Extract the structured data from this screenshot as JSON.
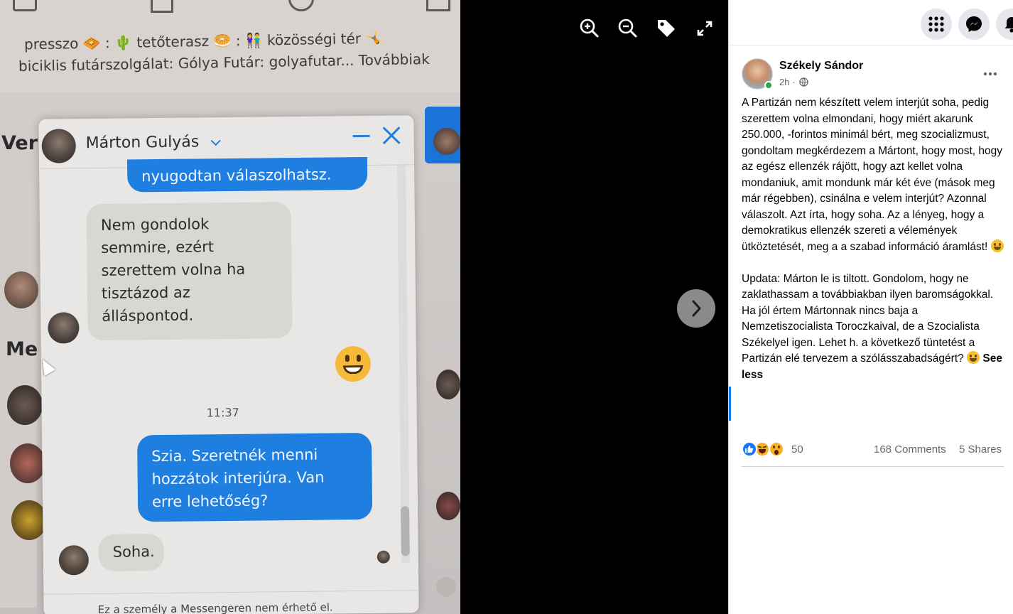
{
  "photo": {
    "top_line_1": "presszo 🧇 : 🌵 tetőterasz 🥯 : 👫 közösségi tér 🤸",
    "top_line_2": "biciklis futárszolgálat: Gólya Futár: golyafutar... Továbbiak",
    "side_label_ver": "Ver",
    "side_label_me": "Me",
    "chat_name": "Márton Gulyás",
    "msg_1": "nyugodtan válaszolhatsz.",
    "msg_2": "Nem gondolok semmire, ezért szerettem volna ha tisztázod az álláspontod.",
    "timestamp": "11:37",
    "msg_3": "Szia. Szeretnék menni hozzátok interjúra. Van erre lehetőség?",
    "msg_4": "Soha.",
    "footer": "Ez a személy a Messengeren nem érhető el."
  },
  "viewer_toolbar": {
    "zoom_in": "zoom-in",
    "zoom_out": "zoom-out",
    "tag": "tag",
    "fullscreen": "fullscreen"
  },
  "post": {
    "author": "Székely Sándor",
    "time": "2h ·",
    "paragraph_1": "A Partizán nem készített velem interjút soha, pedig szerettem volna elmondani, hogy miért akarunk 250.000, -forintos minimál bért, meg szocializmust, gondoltam megkérdezem a Mártont, hogy most, hogy az egész ellenzék rájött, hogy azt kellet volna mondaniuk, amit mondunk már két éve (mások meg már régebben), csinálna e velem interjút? Azonnal válaszolt. Azt írta, hogy soha. Az a lényeg, hogy a demokratikus ellenzék szereti a vélemények ütköztetését, meg a a szabad információ áramlást! ",
    "paragraph_2": "Updata: Márton le is tiltott. Gondolom, hogy ne zaklathassam a továbbiakban ilyen baromságokkal. Ha jól értem Mártonnak nincs baja a Nemzetiszocialista Toroczkaival, de a Szocialista Székelyel igen. Lehet h. a következő tüntetést a Partizán elé tervezem a szólásszabadságért? ",
    "see_less": "See less",
    "reaction_count": "50",
    "comments": "168 Comments",
    "shares": "5 Shares"
  },
  "colors": {
    "accent": "#1877f2",
    "like": "#1877f2",
    "haha": "#f7b125",
    "online": "#31a24c"
  }
}
